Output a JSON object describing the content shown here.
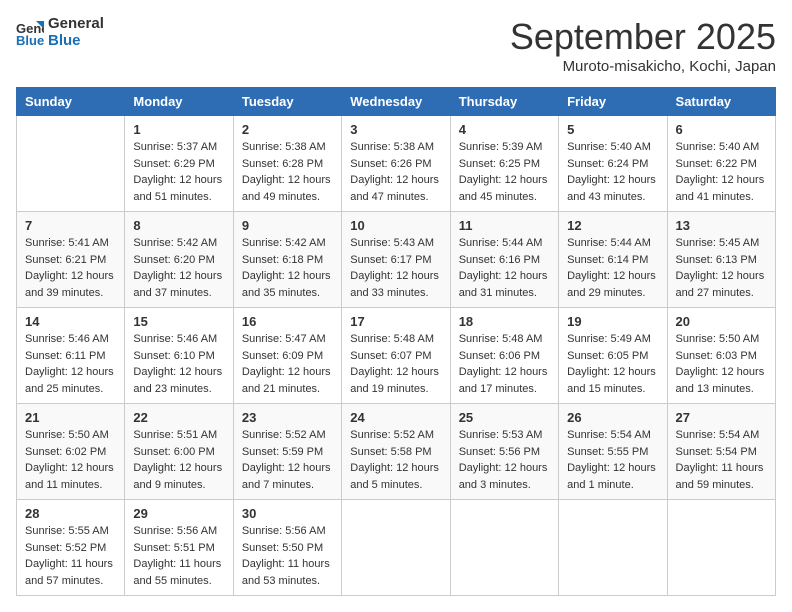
{
  "logo": {
    "line1": "General",
    "line2": "Blue"
  },
  "title": "September 2025",
  "subtitle": "Muroto-misakicho, Kochi, Japan",
  "days_of_week": [
    "Sunday",
    "Monday",
    "Tuesday",
    "Wednesday",
    "Thursday",
    "Friday",
    "Saturday"
  ],
  "weeks": [
    [
      {
        "day": "",
        "info": ""
      },
      {
        "day": "1",
        "info": "Sunrise: 5:37 AM\nSunset: 6:29 PM\nDaylight: 12 hours\nand 51 minutes."
      },
      {
        "day": "2",
        "info": "Sunrise: 5:38 AM\nSunset: 6:28 PM\nDaylight: 12 hours\nand 49 minutes."
      },
      {
        "day": "3",
        "info": "Sunrise: 5:38 AM\nSunset: 6:26 PM\nDaylight: 12 hours\nand 47 minutes."
      },
      {
        "day": "4",
        "info": "Sunrise: 5:39 AM\nSunset: 6:25 PM\nDaylight: 12 hours\nand 45 minutes."
      },
      {
        "day": "5",
        "info": "Sunrise: 5:40 AM\nSunset: 6:24 PM\nDaylight: 12 hours\nand 43 minutes."
      },
      {
        "day": "6",
        "info": "Sunrise: 5:40 AM\nSunset: 6:22 PM\nDaylight: 12 hours\nand 41 minutes."
      }
    ],
    [
      {
        "day": "7",
        "info": "Sunrise: 5:41 AM\nSunset: 6:21 PM\nDaylight: 12 hours\nand 39 minutes."
      },
      {
        "day": "8",
        "info": "Sunrise: 5:42 AM\nSunset: 6:20 PM\nDaylight: 12 hours\nand 37 minutes."
      },
      {
        "day": "9",
        "info": "Sunrise: 5:42 AM\nSunset: 6:18 PM\nDaylight: 12 hours\nand 35 minutes."
      },
      {
        "day": "10",
        "info": "Sunrise: 5:43 AM\nSunset: 6:17 PM\nDaylight: 12 hours\nand 33 minutes."
      },
      {
        "day": "11",
        "info": "Sunrise: 5:44 AM\nSunset: 6:16 PM\nDaylight: 12 hours\nand 31 minutes."
      },
      {
        "day": "12",
        "info": "Sunrise: 5:44 AM\nSunset: 6:14 PM\nDaylight: 12 hours\nand 29 minutes."
      },
      {
        "day": "13",
        "info": "Sunrise: 5:45 AM\nSunset: 6:13 PM\nDaylight: 12 hours\nand 27 minutes."
      }
    ],
    [
      {
        "day": "14",
        "info": "Sunrise: 5:46 AM\nSunset: 6:11 PM\nDaylight: 12 hours\nand 25 minutes."
      },
      {
        "day": "15",
        "info": "Sunrise: 5:46 AM\nSunset: 6:10 PM\nDaylight: 12 hours\nand 23 minutes."
      },
      {
        "day": "16",
        "info": "Sunrise: 5:47 AM\nSunset: 6:09 PM\nDaylight: 12 hours\nand 21 minutes."
      },
      {
        "day": "17",
        "info": "Sunrise: 5:48 AM\nSunset: 6:07 PM\nDaylight: 12 hours\nand 19 minutes."
      },
      {
        "day": "18",
        "info": "Sunrise: 5:48 AM\nSunset: 6:06 PM\nDaylight: 12 hours\nand 17 minutes."
      },
      {
        "day": "19",
        "info": "Sunrise: 5:49 AM\nSunset: 6:05 PM\nDaylight: 12 hours\nand 15 minutes."
      },
      {
        "day": "20",
        "info": "Sunrise: 5:50 AM\nSunset: 6:03 PM\nDaylight: 12 hours\nand 13 minutes."
      }
    ],
    [
      {
        "day": "21",
        "info": "Sunrise: 5:50 AM\nSunset: 6:02 PM\nDaylight: 12 hours\nand 11 minutes."
      },
      {
        "day": "22",
        "info": "Sunrise: 5:51 AM\nSunset: 6:00 PM\nDaylight: 12 hours\nand 9 minutes."
      },
      {
        "day": "23",
        "info": "Sunrise: 5:52 AM\nSunset: 5:59 PM\nDaylight: 12 hours\nand 7 minutes."
      },
      {
        "day": "24",
        "info": "Sunrise: 5:52 AM\nSunset: 5:58 PM\nDaylight: 12 hours\nand 5 minutes."
      },
      {
        "day": "25",
        "info": "Sunrise: 5:53 AM\nSunset: 5:56 PM\nDaylight: 12 hours\nand 3 minutes."
      },
      {
        "day": "26",
        "info": "Sunrise: 5:54 AM\nSunset: 5:55 PM\nDaylight: 12 hours\nand 1 minute."
      },
      {
        "day": "27",
        "info": "Sunrise: 5:54 AM\nSunset: 5:54 PM\nDaylight: 11 hours\nand 59 minutes."
      }
    ],
    [
      {
        "day": "28",
        "info": "Sunrise: 5:55 AM\nSunset: 5:52 PM\nDaylight: 11 hours\nand 57 minutes."
      },
      {
        "day": "29",
        "info": "Sunrise: 5:56 AM\nSunset: 5:51 PM\nDaylight: 11 hours\nand 55 minutes."
      },
      {
        "day": "30",
        "info": "Sunrise: 5:56 AM\nSunset: 5:50 PM\nDaylight: 11 hours\nand 53 minutes."
      },
      {
        "day": "",
        "info": ""
      },
      {
        "day": "",
        "info": ""
      },
      {
        "day": "",
        "info": ""
      },
      {
        "day": "",
        "info": ""
      }
    ]
  ]
}
